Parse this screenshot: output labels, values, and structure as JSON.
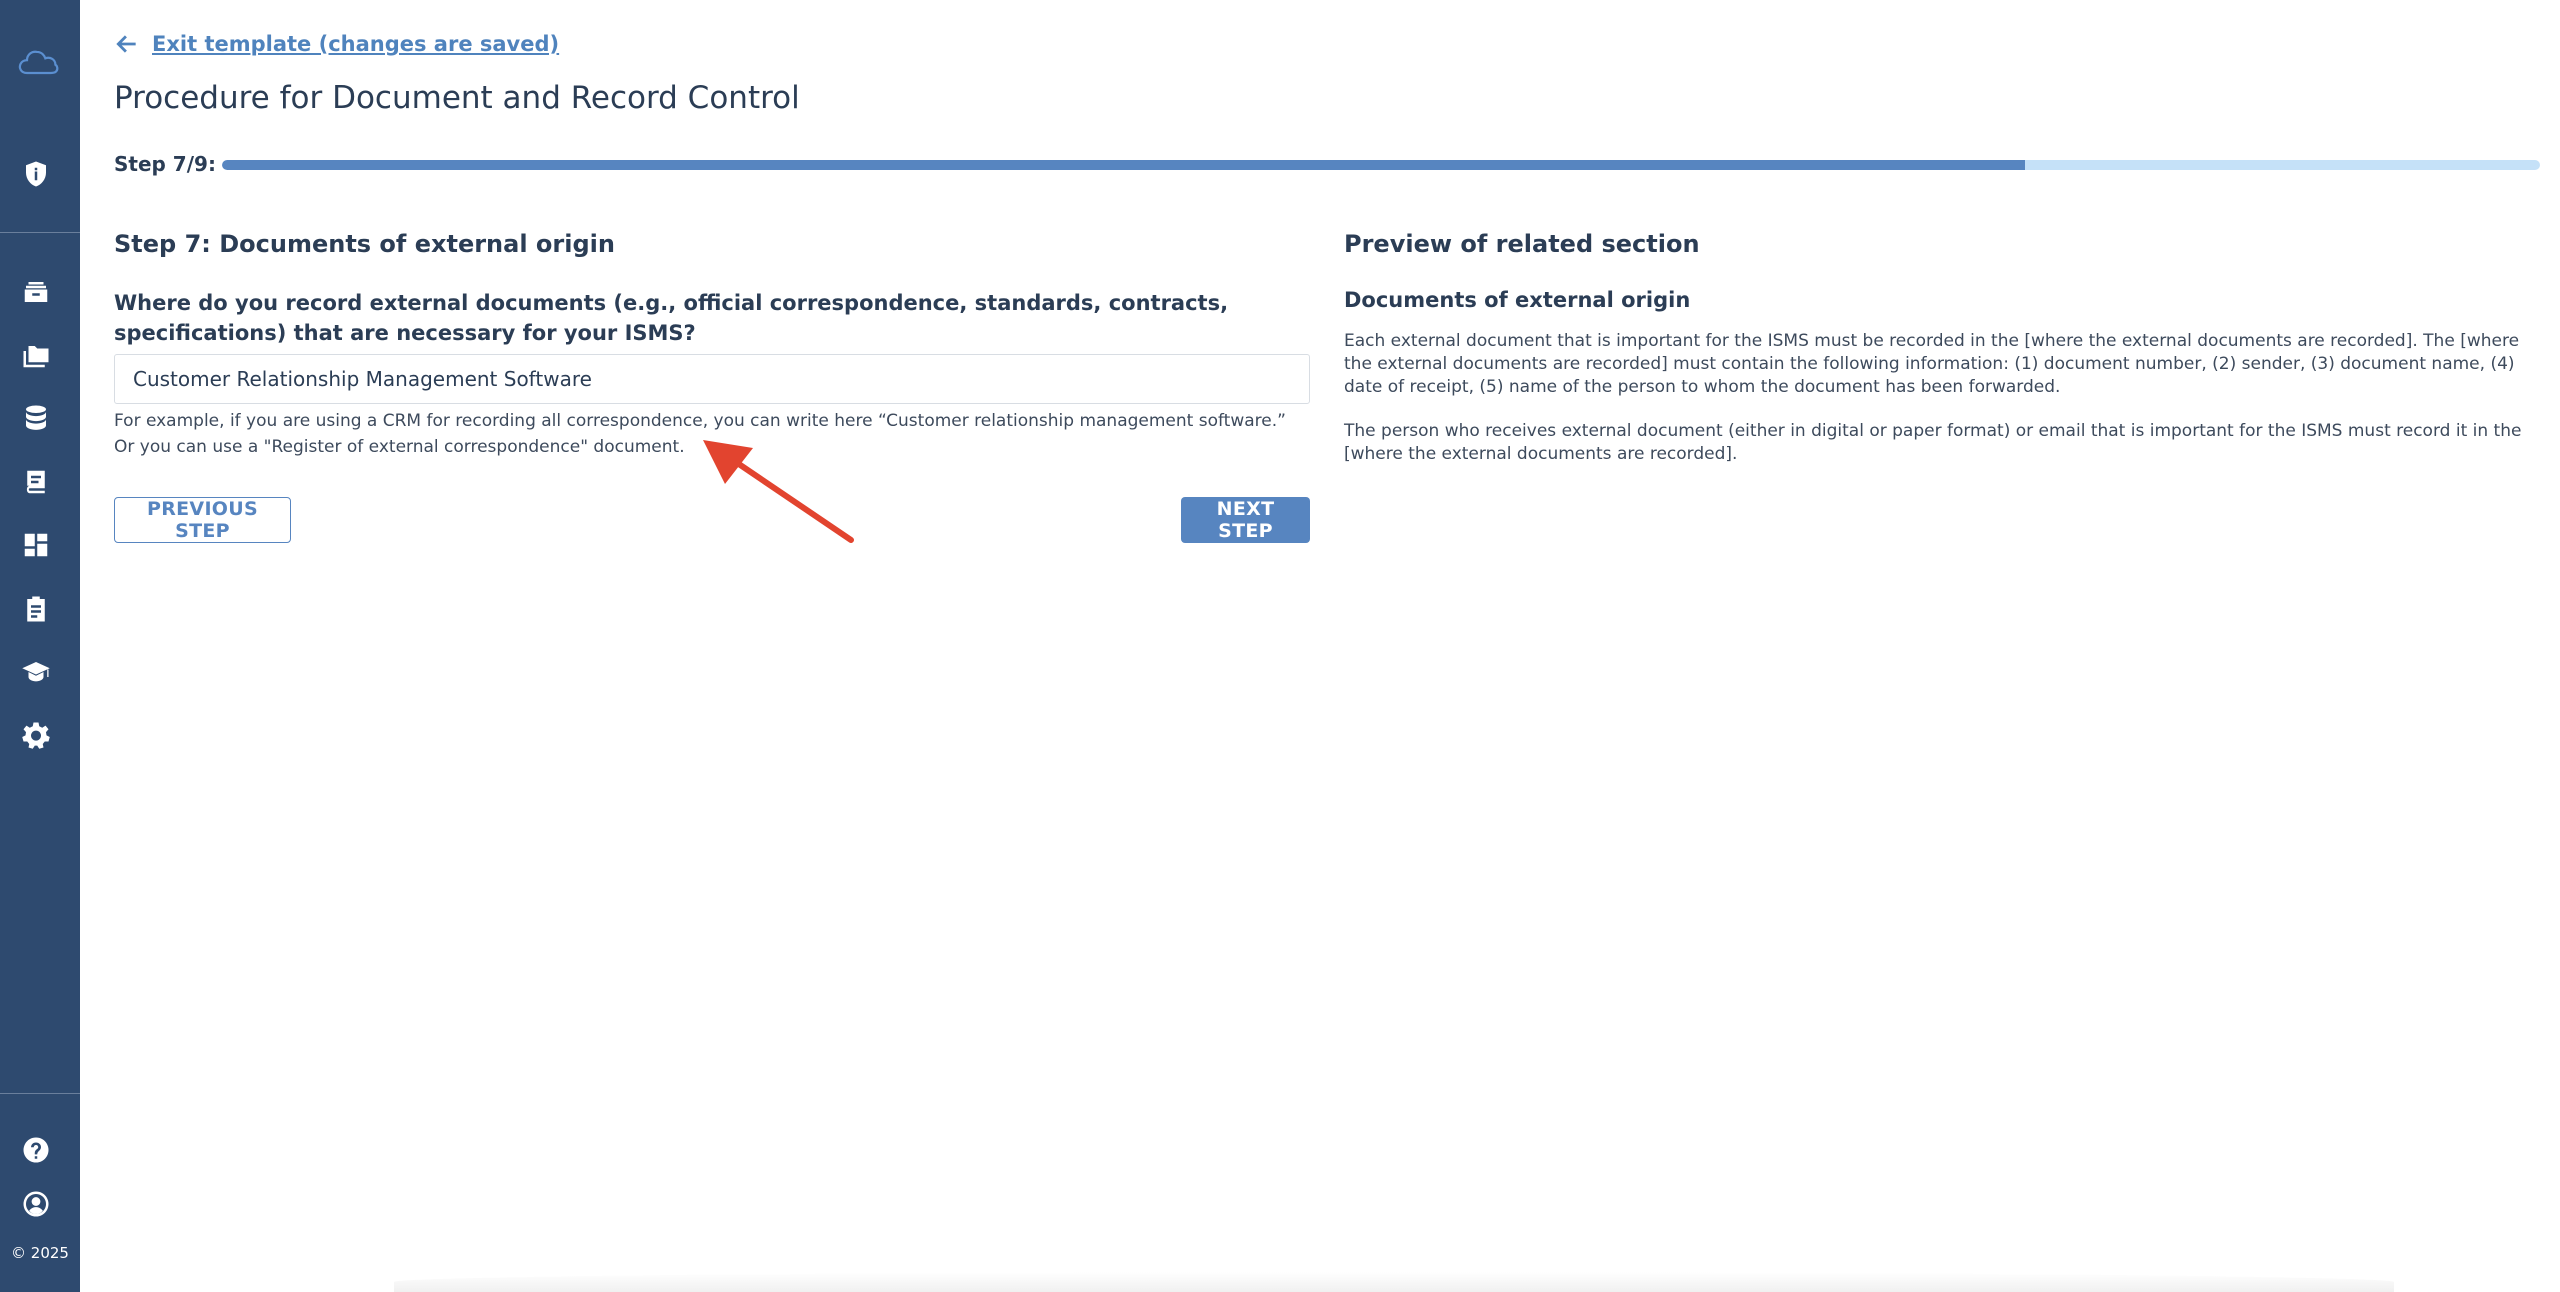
{
  "sidebar": {
    "copyright": "© 2025",
    "icons": [
      "cloud-logo-icon",
      "shield-icon",
      "archive-icon",
      "folder-icon",
      "database-icon",
      "book-icon",
      "dashboard-icon",
      "clipboard-icon",
      "graduation-cap-icon",
      "gear-icon",
      "help-icon",
      "user-account-icon"
    ]
  },
  "header": {
    "exit_link": "Exit template (changes are saved)",
    "title": "Procedure for Document and Record Control"
  },
  "progress": {
    "label": "Step 7/9:",
    "current_step": 7,
    "total_steps": 9,
    "fill_fraction": 0.778
  },
  "step": {
    "title": "Step 7: Documents of external origin",
    "question": "Where do you record external documents (e.g., official correspondence, standards, contracts, specifications) that are necessary for your ISMS?",
    "answer_value": "Customer Relationship Management Software",
    "hint": "For example, if you are using a CRM for recording all correspondence, you can write here “Customer relationship management software.” Or you can use a \"Register of external correspondence\" document.",
    "prev_label": "PREVIOUS STEP",
    "next_label": "NEXT STEP"
  },
  "preview": {
    "title": "Preview of related section",
    "heading": "Documents of external origin",
    "paragraph1": "Each external document that is important for the ISMS must be recorded in the [where the external documents are recorded]. The [where the external documents are recorded] must contain the following information: (1) document number, (2) sender, (3) document name, (4) date of receipt, (5) name of the person to whom the document has been forwarded.",
    "paragraph2": "The person who receives external document (either in digital or paper format) or email that is important for the ISMS must record it in the [where the external documents are recorded]."
  },
  "colors": {
    "sidebar": "#2e4a6f",
    "accent": "#5785c0",
    "progress_track": "#c5e1f8",
    "annotation_arrow": "#e2442f"
  }
}
